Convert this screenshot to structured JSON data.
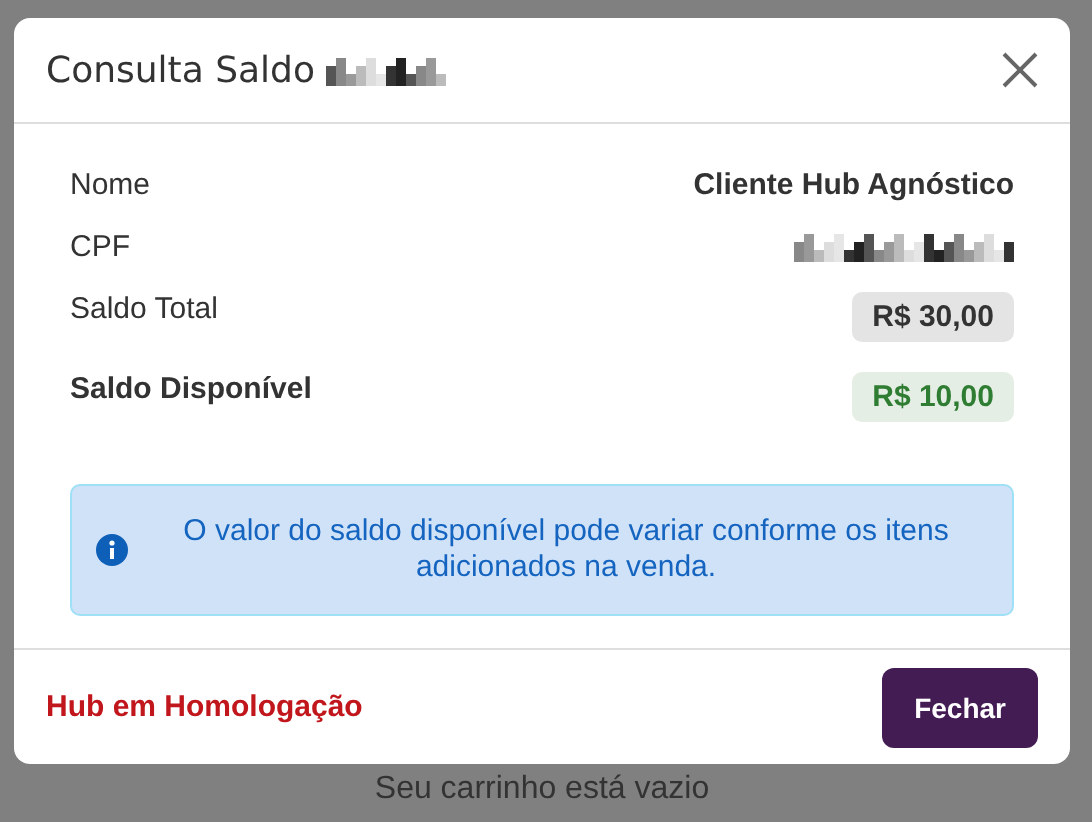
{
  "dialog": {
    "title": "Consulta Saldo",
    "title_redacted": true,
    "rows": [
      {
        "kind": "text",
        "label": "Nome",
        "value": "Cliente Hub Agnóstico",
        "bold": false
      },
      {
        "kind": "redacted",
        "label": "CPF",
        "bold": false
      },
      {
        "kind": "badge",
        "label": "Saldo Total",
        "value": "R$ 30,00",
        "color": "#333333",
        "bold": false
      },
      {
        "kind": "badge",
        "label": "Saldo Disponível",
        "value": "R$ 10,00",
        "color": "#2e7d32",
        "bold": true
      }
    ],
    "alert": "O valor do saldo disponível pode variar conforme os itens adicionados na venda.",
    "environment": "Hub em Homologação",
    "buttons": [
      "Fechar"
    ]
  },
  "background": {
    "empty_message": "Seu carrinho está vazio"
  }
}
